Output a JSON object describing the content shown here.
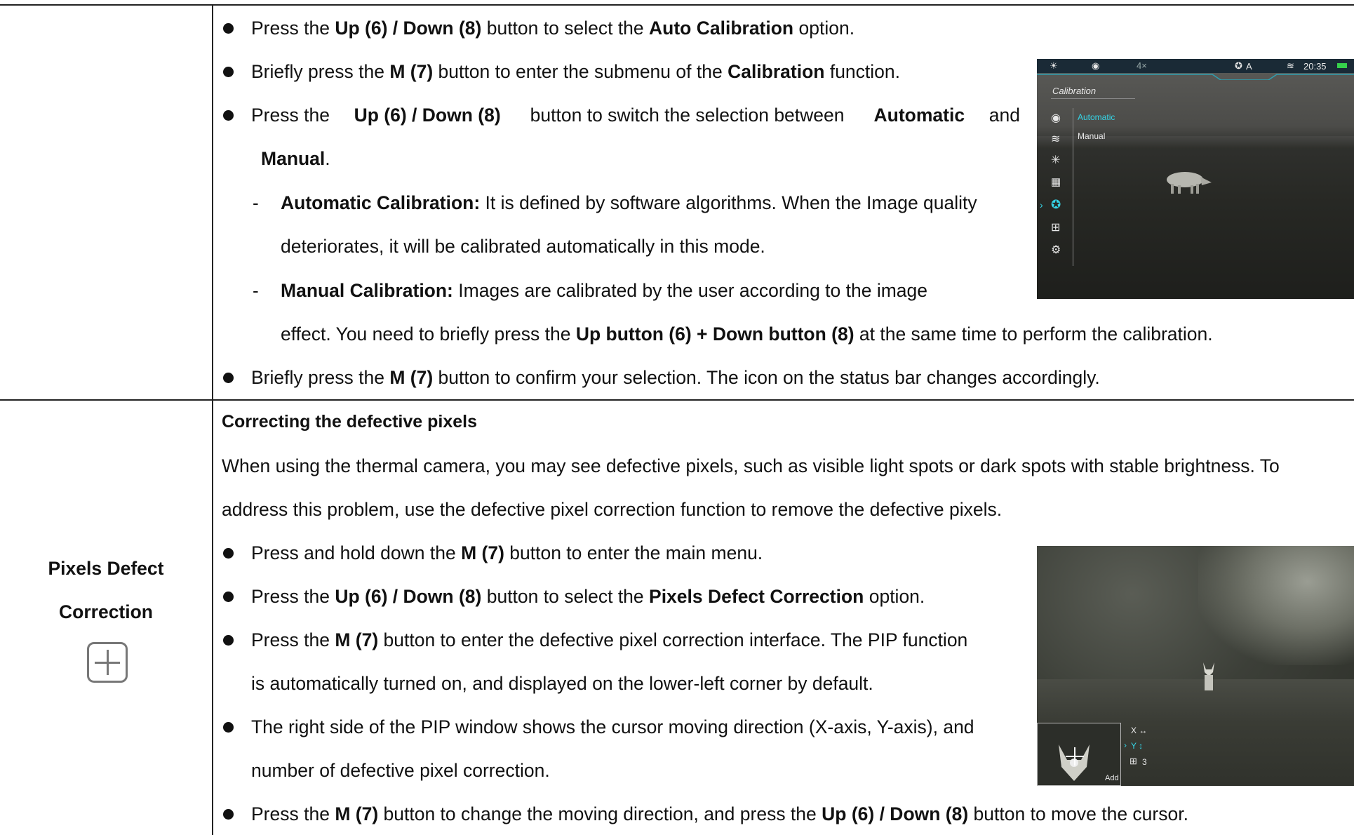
{
  "section1": {
    "b1": {
      "p1": "Press the ",
      "b1": "Up (6) / Down (8)",
      "p2": " button to select the ",
      "b2": "Auto Calibration",
      "p3": " option."
    },
    "b2": {
      "p1": "Briefly press the ",
      "b1": "M (7)",
      "p2": " button to enter the submenu of the ",
      "b2": "Calibration",
      "p3": " function."
    },
    "b3": {
      "p1": "Press the ",
      "b1": "Up (6) / Down (8)",
      "p2": " button to switch the selection between ",
      "b2": "Automatic",
      "p3": " and"
    },
    "b3_cont": {
      "b1": "Manual",
      "p1": "."
    },
    "d1": {
      "dash": "-",
      "b1": "Automatic Calibration:",
      "p1": " It is defined by software algorithms. When the Image quality",
      "line2": "deteriorates, it will be calibrated automatically in this mode."
    },
    "d2": {
      "dash": "-",
      "b1": "Manual Calibration:",
      "p1": " Images are calibrated by the user according to the image",
      "p2": "effect. You need to briefly press the ",
      "b2": "Up button (6) + Down button (8)",
      "p3": " at the same time to perform the calibration."
    },
    "b4": {
      "p1": "Briefly press the ",
      "b1": "M (7)",
      "p2": " button to confirm your selection. The icon on the status bar changes accordingly."
    },
    "screen": {
      "status_zoom": "4×",
      "status_mode": "A",
      "status_time": "20:35",
      "menu_title": "Calibration",
      "option_automatic": "Automatic",
      "option_manual": "Manual",
      "accent": "#35d4e6"
    }
  },
  "section2": {
    "label_line1": "Pixels Defect",
    "label_line2": "Correction",
    "heading": "Correcting the defective pixels",
    "intro_line1": "When using the thermal camera, you may see defective pixels, such as visible light spots or dark spots with stable brightness. To",
    "intro_line2": "address this problem, use the defective pixel correction function to remove the defective pixels.",
    "b1": {
      "p1": "Press and hold down the ",
      "b1": "M (7)",
      "p2": " button to enter the main menu."
    },
    "b2": {
      "p1": "Press the ",
      "b1": "Up (6) / Down (8)",
      "p2": " button to select the ",
      "b2": "Pixels Defect Correction",
      "p3": " option."
    },
    "b3": {
      "p1": "Press the ",
      "b1": "M (7)",
      "p2": " button to enter the defective pixel correction interface. The PIP function",
      "line2": "is automatically turned on, and displayed on the lower-left corner by default."
    },
    "b4": {
      "line1": "The right side of the PIP window shows the cursor moving direction (X-axis, Y-axis), and",
      "line2": "number of defective pixel correction."
    },
    "b5": {
      "p1": "Press the ",
      "b1": "M (7)",
      "p2": " button to change the moving direction, and press the ",
      "b2": "Up (6) / Down (8)",
      "p3": " button to move the cursor."
    },
    "screen": {
      "axis_x": "X ↔",
      "axis_y": "Y ↕",
      "count": "3",
      "pip_label": "Add"
    }
  }
}
